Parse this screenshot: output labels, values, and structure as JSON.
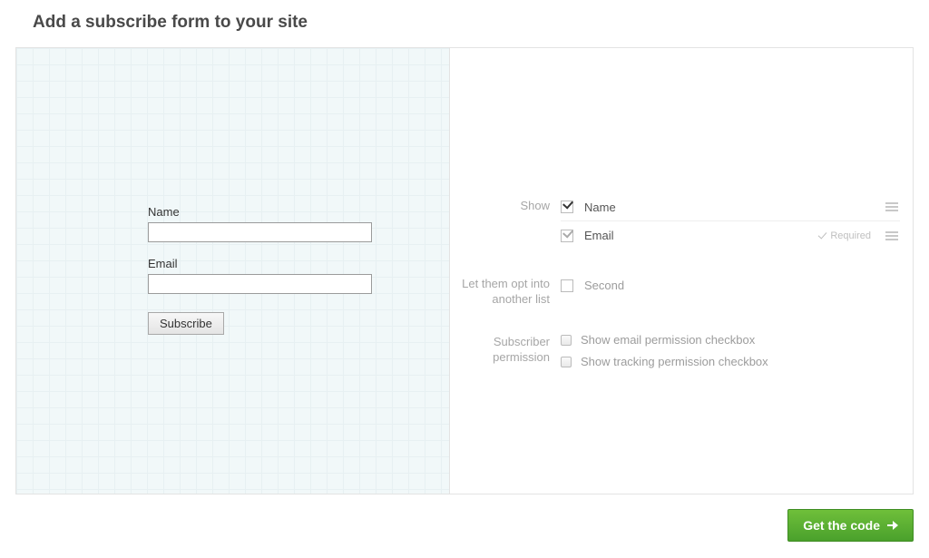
{
  "page_title": "Add a subscribe form to your site",
  "preview": {
    "name_label": "Name",
    "email_label": "Email",
    "subscribe_label": "Subscribe"
  },
  "settings": {
    "show_label": "Show",
    "fields": [
      {
        "label": "Name",
        "checked": true,
        "locked": false,
        "required": false
      },
      {
        "label": "Email",
        "checked": true,
        "locked": true,
        "required": true
      }
    ],
    "required_text": "Required",
    "opt_label": "Let them opt into another list",
    "opt_items": [
      {
        "label": "Second",
        "checked": false
      }
    ],
    "perm_label": "Subscriber permission",
    "perm_items": [
      {
        "label": "Show email permission checkbox",
        "checked": false
      },
      {
        "label": "Show tracking permission checkbox",
        "checked": false
      }
    ]
  },
  "get_code_label": "Get the code"
}
